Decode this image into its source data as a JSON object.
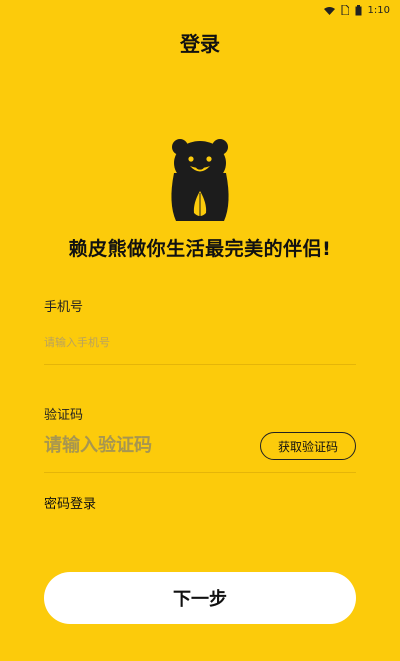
{
  "status_bar": {
    "time": "1:10",
    "icons": [
      "wifi-icon",
      "sim-icon",
      "battery-icon"
    ]
  },
  "header": {
    "title": "登录"
  },
  "branding": {
    "logo_icon": "bear-logo-icon",
    "slogan": "赖皮熊做你生活最完美的伴侣!"
  },
  "form": {
    "phone": {
      "label": "手机号",
      "placeholder": "请输入手机号",
      "value": ""
    },
    "code": {
      "label": "验证码",
      "placeholder": "请输入验证码",
      "value": "",
      "get_code_label": "获取验证码"
    },
    "password_login_label": "密码登录",
    "next_label": "下一步"
  },
  "colors": {
    "background": "#FCCB0B",
    "button_background": "#FFFFFF",
    "text_primary": "#111111",
    "logo_dark": "#1C1C1C",
    "logo_accent": "#FCCB0B"
  }
}
